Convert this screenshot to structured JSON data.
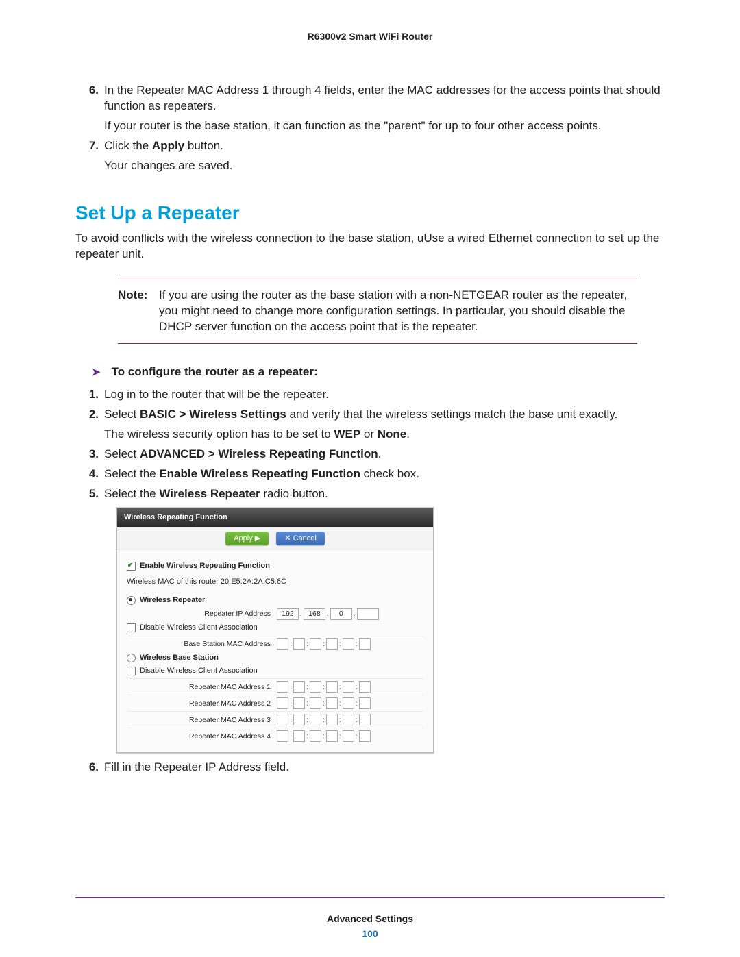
{
  "header": "R6300v2 Smart WiFi Router",
  "prior_steps": {
    "s6": {
      "num": "6.",
      "text": "In the Repeater MAC Address 1 through 4 fields, enter the MAC addresses for the access points that should function as repeaters.",
      "sub": "If your router is the base station, it can function as the \"parent\" for up to four other access points."
    },
    "s7": {
      "num": "7.",
      "text_pre": "Click the ",
      "text_b": "Apply",
      "text_post": " button.",
      "sub": "Your changes are saved."
    }
  },
  "section_title": "Set Up a Repeater",
  "intro": "To avoid conflicts with the wireless connection to the base station, uUse a wired Ethernet connection to set up the repeater unit.",
  "note": {
    "label": "Note:",
    "text": "If you are using the router as the base station with a non-NETGEAR router as the repeater, you might need to change more configuration settings. In particular, you should disable the DHCP server function on the access point that is the repeater."
  },
  "proc_head": "To configure the router as a repeater:",
  "steps": {
    "s1": {
      "num": "1.",
      "text": "Log in to the router that will be the repeater."
    },
    "s2": {
      "num": "2.",
      "pre": "Select ",
      "b1": "BASIC > Wireless Settings",
      "mid": " and verify that the wireless settings match the base unit exactly.",
      "sub_pre": "The wireless security option has to be set to ",
      "sub_b1": "WEP",
      "sub_mid": " or ",
      "sub_b2": "None",
      "sub_post": "."
    },
    "s3": {
      "num": "3.",
      "pre": "Select ",
      "b": "ADVANCED > Wireless Repeating Function",
      "post": "."
    },
    "s4": {
      "num": "4.",
      "pre": "Select the ",
      "b": "Enable Wireless Repeating Function",
      "post": " check box."
    },
    "s5": {
      "num": "5.",
      "pre": "Select the ",
      "b": "Wireless Repeater",
      "post": " radio button."
    },
    "s6": {
      "num": "6.",
      "text": "Fill in the Repeater IP Address field."
    }
  },
  "screenshot": {
    "title": "Wireless Repeating Function",
    "apply": "Apply ▶",
    "cancel": "✕ Cancel",
    "enable_label": "Enable Wireless Repeating Function",
    "mac_of_router": "Wireless MAC of this router 20:E5:2A:2A:C5:6C",
    "wireless_repeater": "Wireless Repeater",
    "repeater_ip_label": "Repeater IP Address",
    "ip": [
      "192",
      "168",
      "0",
      ""
    ],
    "disable_client_assoc": "Disable Wireless Client Association",
    "base_mac_label": "Base Station MAC Address",
    "wireless_base": "Wireless Base Station",
    "mac1": "Repeater MAC Address 1",
    "mac2": "Repeater MAC Address 2",
    "mac3": "Repeater MAC Address 3",
    "mac4": "Repeater MAC Address 4"
  },
  "footer_chapter": "Advanced Settings",
  "footer_page": "100"
}
